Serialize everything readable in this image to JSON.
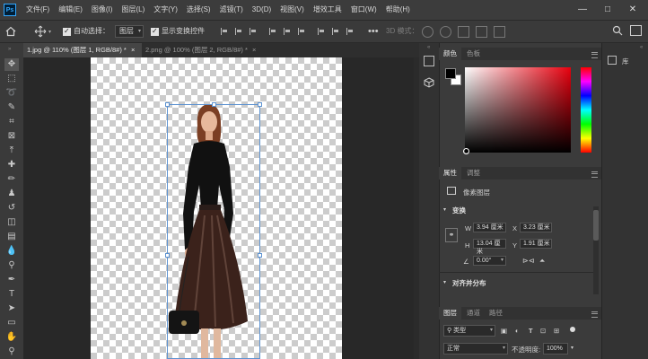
{
  "app": {
    "logo": "Ps"
  },
  "menubar": {
    "items": [
      "文件(F)",
      "编辑(E)",
      "图像(I)",
      "图层(L)",
      "文字(Y)",
      "选择(S)",
      "滤镜(T)",
      "3D(D)",
      "视图(V)",
      "增效工具",
      "窗口(W)",
      "帮助(H)"
    ],
    "minimize": "—",
    "maximize": "□",
    "close": "✕"
  },
  "options": {
    "auto_select_label": "自动选择：",
    "auto_select_value": "图层",
    "show_transform_label": "显示变换控件",
    "mode_3d_label": "3D 模式："
  },
  "tabs": [
    {
      "label": "1.jpg @ 110% (图层 1, RGB/8#) *",
      "close": "×"
    },
    {
      "label": "2.png @ 100% (图层 2, RGB/8#) *",
      "close": "×"
    }
  ],
  "color_panel": {
    "tabs": [
      "颜色",
      "色板"
    ]
  },
  "properties_panel": {
    "tabs": [
      "属性",
      "调整"
    ],
    "pixel_layer": "像素图层",
    "transform_header": "变换",
    "w_label": "W",
    "w_value": "3.94 厘米",
    "x_label": "X",
    "x_value": "3.23 厘米",
    "h_label": "H",
    "h_value": "13.04 厘米",
    "y_label": "Y",
    "y_value": "1.91 厘米",
    "angle_value": "0.00°",
    "align_header": "对齐并分布"
  },
  "layers_panel": {
    "tabs": [
      "图层",
      "通道",
      "路径"
    ],
    "filter_label": "类型",
    "blend_mode": "正常",
    "opacity_label": "不透明度:",
    "opacity_value": "100%"
  },
  "library_panel": {
    "label": "库"
  },
  "colors": {
    "accent": "#31a8ff",
    "bbox": "#5e93d1",
    "foreground": "#000000",
    "background": "#ffffff"
  }
}
